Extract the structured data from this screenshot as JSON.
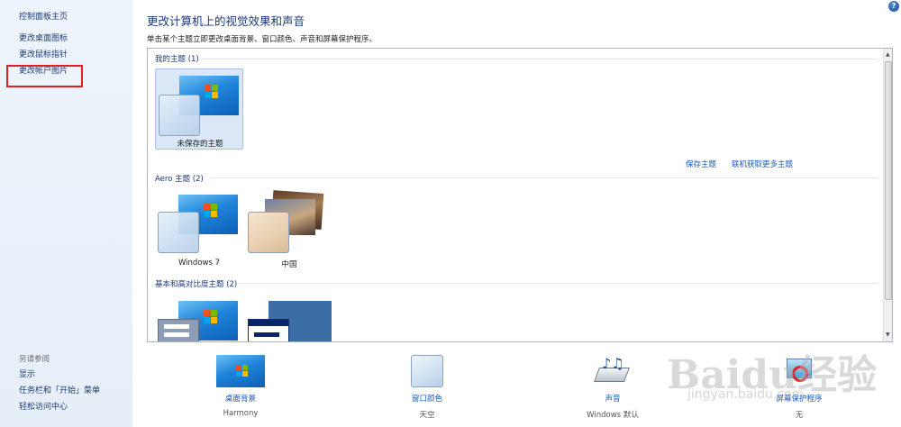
{
  "sidebar": {
    "home": "控制面板主页",
    "items": [
      {
        "label": "更改桌面图标"
      },
      {
        "label": "更改鼠标指针"
      },
      {
        "label": "更改帐户图片"
      }
    ],
    "see_also_title": "另请参阅",
    "see_also": [
      {
        "label": "显示"
      },
      {
        "label": "任务栏和「开始」菜单"
      },
      {
        "label": "轻松访问中心"
      }
    ]
  },
  "header": {
    "title": "更改计算机上的视觉效果和声音",
    "subtitle": "单击某个主题立即更改桌面背景、窗口颜色、声音和屏幕保护程序。",
    "help_icon": "?"
  },
  "themes": {
    "my_section": "我的主题 (1)",
    "unsaved_theme": "未保存的主题",
    "save_theme": "保存主题",
    "get_more": "联机获取更多主题",
    "aero_section": "Aero 主题 (2)",
    "aero_themes": [
      {
        "label": "Windows 7"
      },
      {
        "label": "中国"
      }
    ],
    "basic_section": "基本和高对比度主题 (2)"
  },
  "tools": {
    "background": {
      "name": "桌面背景",
      "value": "Harmony"
    },
    "color": {
      "name": "窗口颜色",
      "value": "天空"
    },
    "sound": {
      "name": "声音",
      "value": "Windows 默认"
    },
    "screensaver": {
      "name": "屏幕保护程序",
      "value": "无"
    }
  },
  "watermark": {
    "text": "Baidu经验",
    "url": "jingyan.baidu.com"
  },
  "colors": {
    "accent": "#1a58b8",
    "highlight_box": "#e02020"
  }
}
